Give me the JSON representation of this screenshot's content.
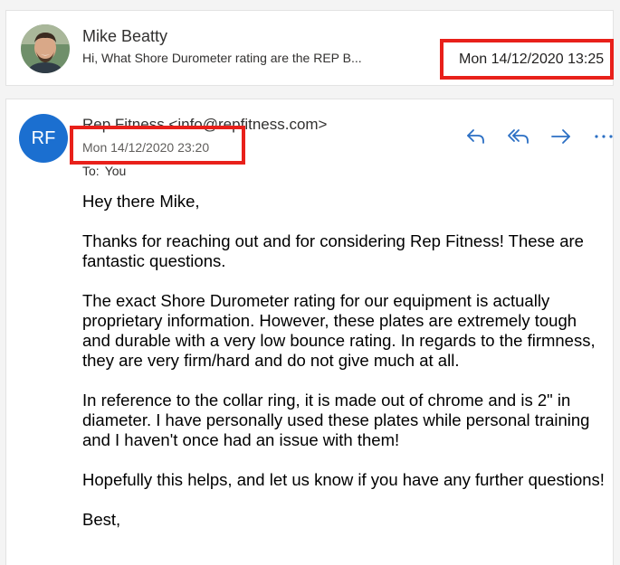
{
  "collapsed_message": {
    "sender": "Mike Beatty",
    "preview": "Hi, What Shore Durometer rating are the REP B...",
    "date": "Mon 14/12/2020 13:25",
    "avatar_icon": "person-photo-icon"
  },
  "expanded_message": {
    "avatar_initials": "RF",
    "sender": "Rep Fitness <info@repfitness.com>",
    "date": "Mon 14/12/2020 23:20",
    "to_label": "To:",
    "to_value": "You",
    "actions": {
      "reply_icon": "reply-icon",
      "reply_all_icon": "reply-all-icon",
      "forward_icon": "forward-icon",
      "more_icon": "more-options-icon"
    },
    "body": {
      "greeting": "Hey there Mike,",
      "paragraph1": "Thanks for reaching out and for considering Rep Fitness! These are fantastic questions.",
      "paragraph2": "The exact Shore Durometer rating for our equipment is actually proprietary information. However, these plates are extremely tough and durable with a very low bounce rating. In regards to the firmness, they are very firm/hard and do not give much at all.",
      "paragraph3": "In reference to the collar ring, it is made out of chrome and is 2\" in diameter. I have personally used these plates while personal training and I haven't once had an issue with them!",
      "paragraph4": "Hopefully this helps, and let us know if you have any further questions!",
      "closing": "Best,"
    }
  },
  "colors": {
    "accent": "#1b6fd0",
    "highlight": "#e8201a",
    "action_icon": "#2b6fc4"
  }
}
